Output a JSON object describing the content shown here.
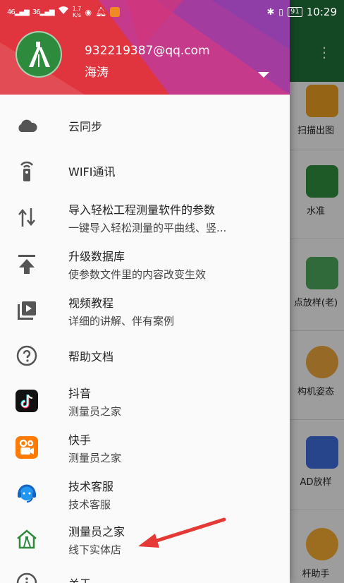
{
  "status_bar": {
    "signal1": "46",
    "signal2": "36",
    "speed_value": "1.7",
    "speed_unit": "K/s",
    "battery": "91",
    "time": "10:29"
  },
  "account": {
    "email": "932219387@qq.com",
    "name": "海涛"
  },
  "menu": {
    "items": [
      {
        "title": "云同步",
        "subtitle": ""
      },
      {
        "title": "WIFI通讯",
        "subtitle": ""
      },
      {
        "title": "导入轻松工程测量软件的参数",
        "subtitle": "一键导入轻松测量的平曲线、竖..."
      },
      {
        "title": "升级数据库",
        "subtitle": "使参数文件里的内容改变生效"
      },
      {
        "title": "视频教程",
        "subtitle": "详细的讲解、伴有案例"
      },
      {
        "title": "帮助文档",
        "subtitle": ""
      },
      {
        "title": "抖音",
        "subtitle": "测量员之家"
      },
      {
        "title": "快手",
        "subtitle": "测量员之家"
      },
      {
        "title": "技术客服",
        "subtitle": "技术客服"
      },
      {
        "title": "测量员之家",
        "subtitle": "线下实体店"
      },
      {
        "title": "关于",
        "subtitle": ""
      }
    ]
  },
  "background_app": {
    "tiles": [
      {
        "label": "扫描出图"
      },
      {
        "label": "水准"
      },
      {
        "label": "点放样(老)"
      },
      {
        "label": "构机姿态"
      },
      {
        "label": "AD放样"
      },
      {
        "label": "杆助手"
      }
    ]
  },
  "colors": {
    "header_red": "#e0343f",
    "header_purple": "#a23c9e",
    "avatar_green": "#2e8b3e",
    "arrow_red": "#e53935"
  }
}
